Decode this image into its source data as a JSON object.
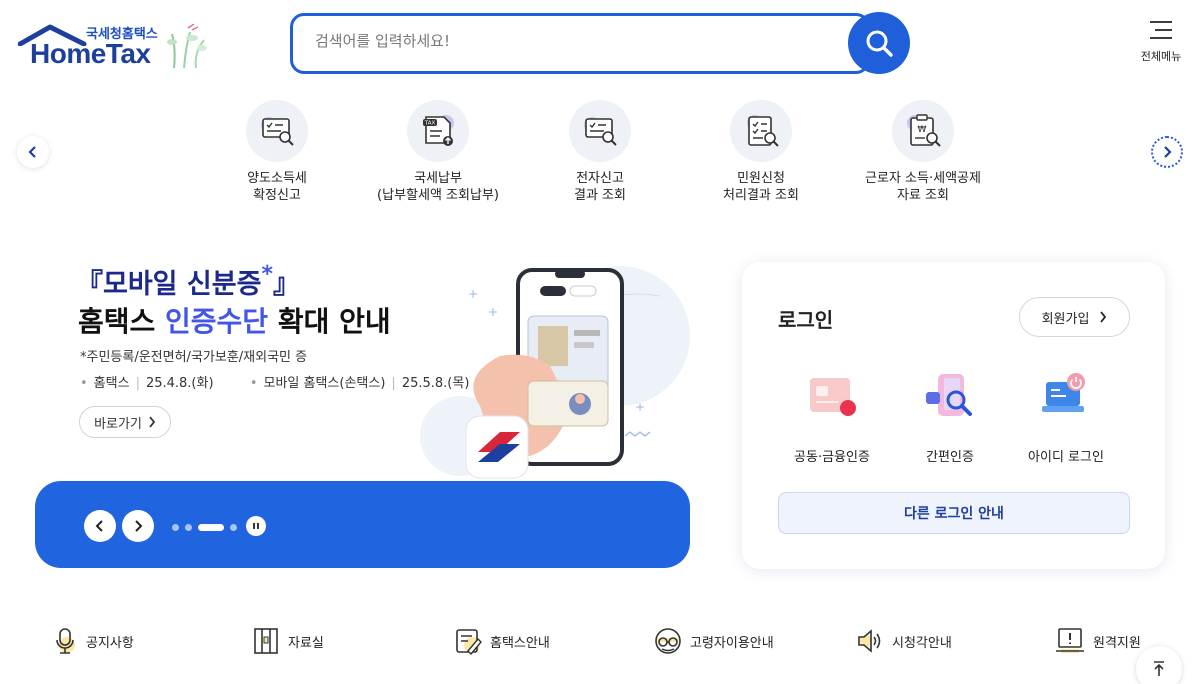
{
  "header": {
    "logo_kr": "국세청홈택스",
    "logo_en": "HomeTax",
    "search_placeholder": "검색어를 입력하세요!",
    "all_menu_label": "전체메뉴"
  },
  "quick_menu": [
    {
      "label": "양도소득세\n확정신고",
      "icon": "capital-gains-tax-icon"
    },
    {
      "label": "국세납부\n(납부할세액 조회납부)",
      "icon": "tax-payment-icon"
    },
    {
      "label": "전자신고\n결과 조회",
      "icon": "e-filing-result-icon"
    },
    {
      "label": "민원신청\n처리결과 조회",
      "icon": "civil-request-result-icon"
    },
    {
      "label": "근로자 소득·세액공제\n자료 조회",
      "icon": "worker-deduction-data-icon"
    }
  ],
  "banner": {
    "title_prefix": "『모바일 신분증",
    "title_star": "*",
    "title_suffix": "』",
    "title2_pre": "홈택스 ",
    "title2_highlight": "인증수단",
    "title2_post": " 확대 안내",
    "note": "*주민등록/운전면허/국가보훈/재외국민 증",
    "date1_label": "홈택스",
    "date1_value": "25.4.8.(화)",
    "date2_label": "모바일 홈택스(손택스)",
    "date2_value": "25.5.8.(목)",
    "button_label": "바로가기"
  },
  "login": {
    "title": "로그인",
    "signup_label": "회원가입",
    "options": [
      {
        "label": "공동·금융인증",
        "icon": "certificate-icon"
      },
      {
        "label": "간편인증",
        "icon": "simple-auth-icon"
      },
      {
        "label": "아이디 로그인",
        "icon": "id-login-icon"
      }
    ],
    "other_login_label": "다른 로그인 안내"
  },
  "bottom_links": [
    {
      "label": "공지사항",
      "icon": "microphone-icon"
    },
    {
      "label": "자료실",
      "icon": "archive-icon"
    },
    {
      "label": "홈택스안내",
      "icon": "guide-icon"
    },
    {
      "label": "고령자이용안내",
      "icon": "senior-glasses-icon"
    },
    {
      "label": "시청각안내",
      "icon": "speaker-icon"
    },
    {
      "label": "원격지원",
      "icon": "remote-support-icon"
    }
  ],
  "colors": {
    "primary": "#1f5fd9",
    "banner_blue": "#2164e0",
    "title_navy": "#1b2a8a",
    "highlight": "#4256e8"
  }
}
